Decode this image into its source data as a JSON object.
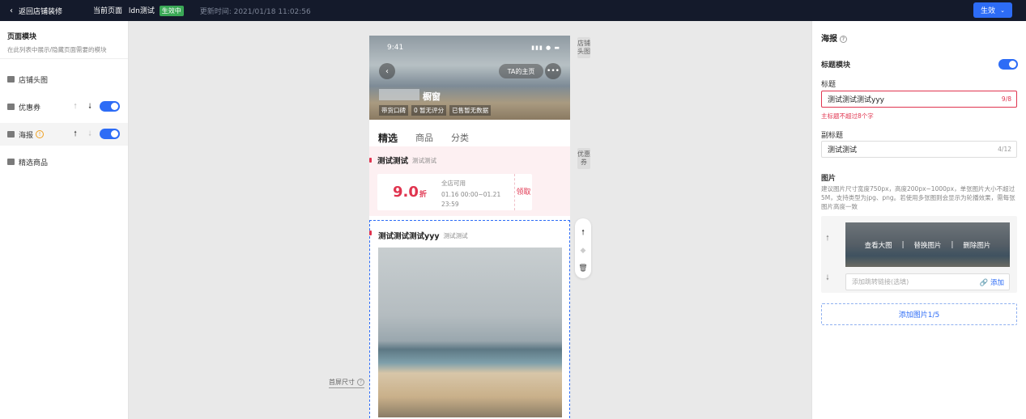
{
  "topbar": {
    "back_label": "返回店铺装修",
    "current_page_label": "当前页面",
    "page_name": "ldn测试",
    "status_badge": "生效中",
    "update_time": "更新时间: 2021/01/18 11:02:56",
    "publish_label": "生效"
  },
  "left": {
    "title": "页面模块",
    "subtitle": "在此列表中展示/隐藏页面需要的模块",
    "modules": [
      {
        "label": "店铺头图"
      },
      {
        "label": "优惠券"
      },
      {
        "label": "海报"
      },
      {
        "label": "精选商品"
      }
    ]
  },
  "phone": {
    "time": "9:41",
    "ta_home": "TA的主页",
    "shop_name": "橱窗",
    "chips": [
      "带货口碑",
      "0 暂无评分",
      "已售暂无数据"
    ],
    "tabs": [
      "精选",
      "商品",
      "分类"
    ],
    "coupon_section": {
      "title": "测试测试",
      "subtitle": "测试测试"
    },
    "coupon": {
      "amount": "9.0",
      "unit": "折",
      "scope": "全店可用",
      "period": "01.16 00:00~01.21 23:59",
      "claim": "领取"
    },
    "poster_section": {
      "title": "测试测试测试yyy",
      "subtitle": "测试测试"
    }
  },
  "side_labels": {
    "header": "店铺头图",
    "coupon": "优惠券"
  },
  "first_screen": "首屏尺寸",
  "right": {
    "title": "海报",
    "title_module": "标题模块",
    "title_label": "标题",
    "title_value": "测试测试测试yyy",
    "title_count": "9/8",
    "title_error": "主标题不超过8个字",
    "subtitle_label": "副标题",
    "subtitle_value": "测试测试",
    "subtitle_count": "4/12",
    "image_label": "图片",
    "image_hint": "建议图片尺寸宽度750px，高度200px~1000px，单张图片大小不超过5M，支持类型为jpg、png。若使用多张图则会显示为轮播效果，需每张图片高度一致",
    "actions": [
      "查看大图",
      "替换图片",
      "删除图片"
    ],
    "link_placeholder": "添加跳转链接(选填)",
    "link_add": "添加",
    "add_image": "添加图片1/5"
  },
  "colors": {
    "accent": "#2d6cf6",
    "error": "#e0344f",
    "success": "#3aa856",
    "topbar": "#141a2b"
  }
}
